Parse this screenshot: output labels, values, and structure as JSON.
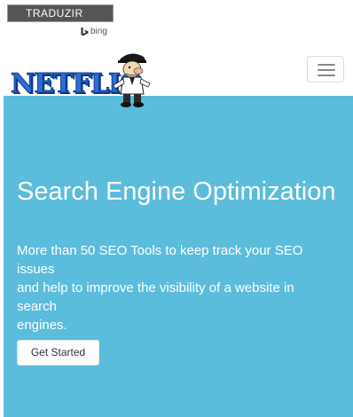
{
  "translate": {
    "button_label": "TRADUZIR",
    "provider": "bing",
    "provider_icon": "bing-logo-icon"
  },
  "navbar": {
    "logo_text": "NETFLIC",
    "logo_icon": "mascot-icon",
    "menu_icon": "hamburger-menu-icon"
  },
  "hero": {
    "background_color": "#5bbcdb",
    "title": "Search Engine Optimization",
    "subtitle_lines": [
      "More than 50 SEO Tools to keep track your SEO",
      "issues",
      "and help to improve the visibility of a website in",
      "search",
      "engines."
    ],
    "cta_label": "Get Started"
  }
}
